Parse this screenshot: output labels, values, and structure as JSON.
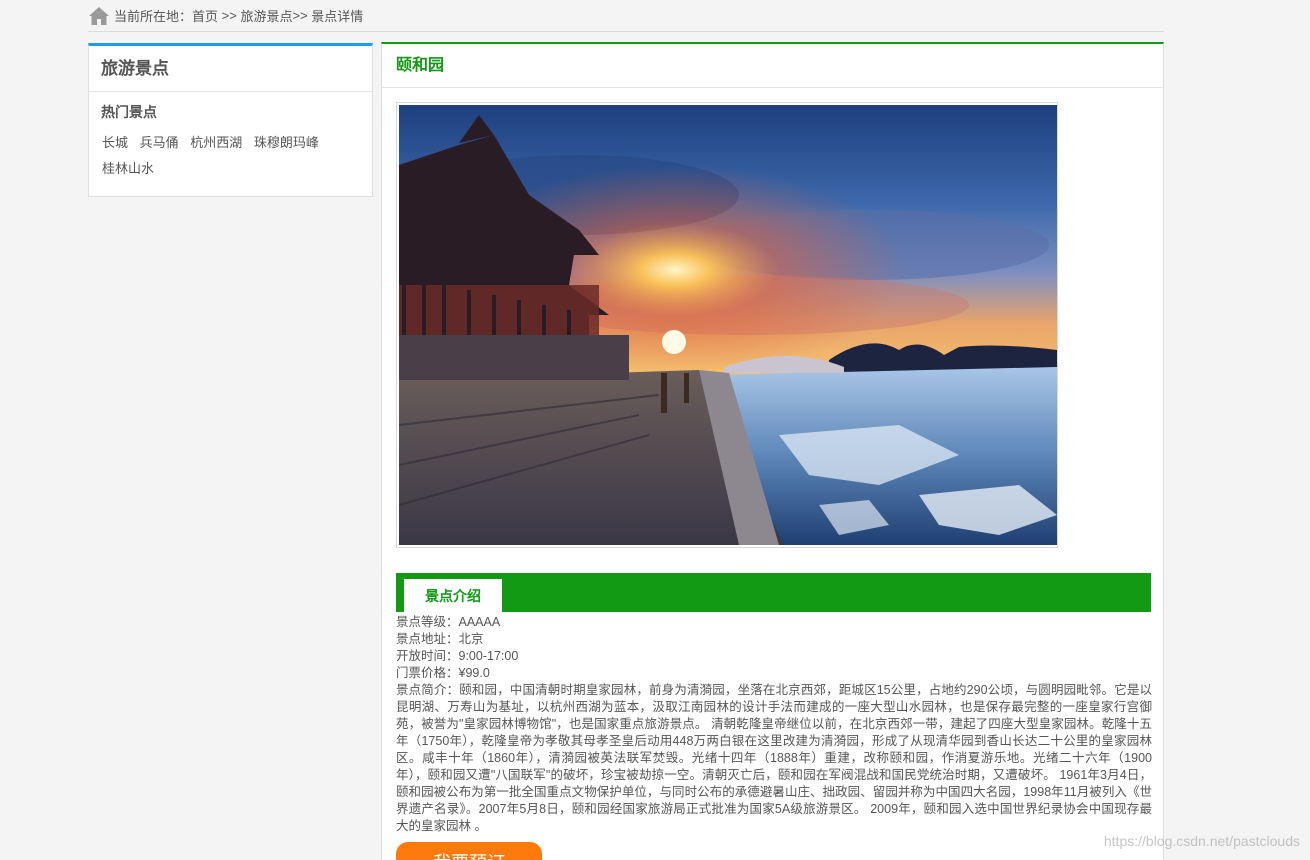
{
  "breadcrumb": {
    "prefix": "当前所在地：",
    "home": "首页",
    "sep1": " >> ",
    "category": "旅游景点",
    "sep2": ">> ",
    "current": "景点详情"
  },
  "sidebar": {
    "title": "旅游景点",
    "subtitle": "热门景点",
    "links": [
      "长城",
      "兵马俑",
      "杭州西湖",
      "珠穆朗玛峰",
      "桂林山水"
    ]
  },
  "main": {
    "title": "颐和园",
    "tab_label": "景点介绍",
    "level": "景点等级：AAAAA",
    "address": "景点地址：北京",
    "hours": "开放时间：9:00-17:00",
    "price": "门票价格：¥99.0",
    "intro": "景点简介：颐和园，中国清朝时期皇家园林，前身为清漪园，坐落在北京西郊，距城区15公里，占地约290公顷，与圆明园毗邻。它是以昆明湖、万寿山为基址，以杭州西湖为蓝本，汲取江南园林的设计手法而建成的一座大型山水园林，也是保存最完整的一座皇家行宫御苑，被誉为\"皇家园林博物馆\"，也是国家重点旅游景点。 清朝乾隆皇帝继位以前，在北京西郊一带，建起了四座大型皇家园林。乾隆十五年（1750年），乾隆皇帝为孝敬其母孝圣皇后动用448万两白银在这里改建为清漪园，形成了从现清华园到香山长达二十公里的皇家园林区。咸丰十年（1860年），清漪园被英法联军焚毁。光绪十四年（1888年）重建，改称颐和园，作消夏游乐地。光绪二十六年（1900年），颐和园又遭\"八国联军\"的破坏，珍宝被劫掠一空。清朝灭亡后，颐和园在军阀混战和国民党统治时期，又遭破坏。 1961年3月4日，颐和园被公布为第一批全国重点文物保护单位，与同时公布的承德避暑山庄、拙政园、留园并称为中国四大名园，1998年11月被列入《世界遗产名录》。2007年5月8日，颐和园经国家旅游局正式批准为国家5A级旅游景区。 2009年，颐和园入选中国世界纪录协会中国现存最大的皇家园林 。",
    "book_button": "我要预订"
  },
  "watermark": "https://blog.csdn.net/pastclouds",
  "colors": {
    "accent_green": "#129a15",
    "accent_blue": "#1e9fe0",
    "button_orange": "#ff7a0c"
  },
  "icons": {
    "home": "home-icon"
  }
}
